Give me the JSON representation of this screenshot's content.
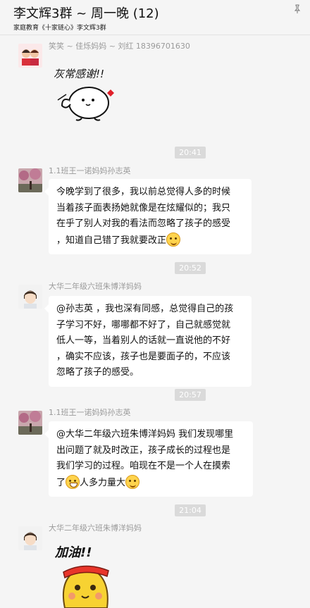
{
  "header": {
    "title": "李文辉3群 ~ 周一晚 (12)",
    "subtitle": "家庭教育《十家链心》李文辉3群",
    "pin_icon": "pin-icon"
  },
  "messages": [
    {
      "sender": "笑笑 ~ 佳烁妈妈 ~ 刘红 18396701630",
      "sticker_text": "灰常感谢!!"
    },
    {
      "time": "20:41",
      "sender": "1.1班王一诺妈妈孙志英",
      "lines": [
        "今晚学到了很多，我以前总觉得人多的时候",
        "当着孩子面表扬她就像是在炫耀似的；我只",
        "在乎了别人对我的看法而忽略了孩子的感受",
        "，知道自己错了我就要改正"
      ]
    },
    {
      "time": "20:52",
      "sender": "大华二年级六班朱博洋妈妈",
      "lines": [
        "@孙志英 ，我也深有同感，总觉得自己的孩",
        "子学习不好，哪哪都不好了，自己就感觉就",
        "低人一等，当着别人的话就一直说他的不好",
        "，确实不应该，孩子也是要面子的，不应该",
        "忽略了孩子的感受。"
      ]
    },
    {
      "time": "20:57",
      "sender": "1.1班王一诺妈妈孙志英",
      "lines": [
        "@大华二年级六班朱博洋妈妈 我们发现哪里",
        "出问题了就及时改正，孩子成长的过程也是",
        "我们学习的过程。咱现在不是一个人在摸索",
        "了",
        "人多力量大"
      ]
    },
    {
      "time": "21:04",
      "sender": "大华二年级六班朱博洋妈妈",
      "sticker_text": "加油!!"
    }
  ]
}
